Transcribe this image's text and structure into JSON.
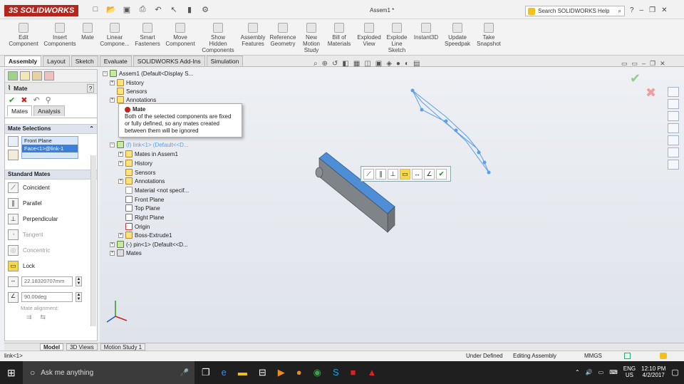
{
  "app": {
    "logo": "3S SOLIDWORKS",
    "document_title": "Assem1 *"
  },
  "help_search": {
    "placeholder": "Search SOLIDWORKS Help"
  },
  "ribbon": [
    {
      "id": "edit-component",
      "label": "Edit\nComponent"
    },
    {
      "id": "insert-components",
      "label": "Insert\nComponents"
    },
    {
      "id": "mate",
      "label": "Mate"
    },
    {
      "id": "linear-component",
      "label": "Linear\nCompone..."
    },
    {
      "id": "smart-fasteners",
      "label": "Smart\nFasteners"
    },
    {
      "id": "move-component",
      "label": "Move\nComponent"
    },
    {
      "id": "show-hidden",
      "label": "Show\nHidden\nComponents"
    },
    {
      "id": "assembly-features",
      "label": "Assembly\nFeatures"
    },
    {
      "id": "reference-geometry",
      "label": "Reference\nGeometry"
    },
    {
      "id": "new-motion-study",
      "label": "New\nMotion\nStudy"
    },
    {
      "id": "bill-of-materials",
      "label": "Bill of\nMaterials"
    },
    {
      "id": "exploded-view",
      "label": "Exploded\nView"
    },
    {
      "id": "explode-line-sketch",
      "label": "Explode\nLine\nSketch"
    },
    {
      "id": "instant3d",
      "label": "Instant3D"
    },
    {
      "id": "update-speedpak",
      "label": "Update\nSpeedpak"
    },
    {
      "id": "take-snapshot",
      "label": "Take\nSnapshot"
    }
  ],
  "tabs": [
    "Assembly",
    "Layout",
    "Sketch",
    "Evaluate",
    "SOLIDWORKS Add-Ins",
    "Simulation"
  ],
  "property_manager": {
    "title": "Mate",
    "help": "?",
    "subtabs": [
      "Mates",
      "Analysis"
    ],
    "mate_selections_title": "Mate Selections",
    "selections": [
      "Front Plane",
      "Face<1>@link-1"
    ],
    "standard_mates_title": "Standard Mates",
    "mates": [
      {
        "label": "Coincident",
        "enabled": true
      },
      {
        "label": "Parallel",
        "enabled": true
      },
      {
        "label": "Perpendicular",
        "enabled": true
      },
      {
        "label": "Tangent",
        "enabled": false
      },
      {
        "label": "Concentric",
        "enabled": false
      },
      {
        "label": "Lock",
        "enabled": true
      }
    ],
    "distance_value": "22.18320707mm",
    "angle_value": "90.00deg",
    "mate_alignment": "Mate alignment:"
  },
  "tree": {
    "root": "Assem1  (Default<Display S...",
    "items": [
      {
        "label": "History",
        "indent": 1
      },
      {
        "label": "Sensors",
        "indent": 1
      },
      {
        "label": "Annotations",
        "indent": 1
      },
      {
        "label": "(f) link<1> (Default<<D...",
        "indent": 1
      },
      {
        "label": "Mates in Assem1",
        "indent": 2
      },
      {
        "label": "History",
        "indent": 2
      },
      {
        "label": "Sensors",
        "indent": 2
      },
      {
        "label": "Annotations",
        "indent": 2
      },
      {
        "label": "Material <not specif...",
        "indent": 2
      },
      {
        "label": "Front Plane",
        "indent": 2
      },
      {
        "label": "Top Plane",
        "indent": 2
      },
      {
        "label": "Right Plane",
        "indent": 2
      },
      {
        "label": "Origin",
        "indent": 2
      },
      {
        "label": "Boss-Extrude1",
        "indent": 2
      },
      {
        "label": "(-) pin<1> (Default<<D...",
        "indent": 1
      },
      {
        "label": "Mates",
        "indent": 1
      }
    ]
  },
  "tooltip": {
    "title": "Mate",
    "message": "Both of the selected components are fixed or fully defined, so any mates created between them will be ignored"
  },
  "bottom_tabs": [
    "Model",
    "3D Views",
    "Motion Study 1"
  ],
  "status": {
    "left": "link<1>",
    "define_state": "Under Defined",
    "mode": "Editing Assembly",
    "units": "MMGS"
  },
  "taskbar": {
    "search_placeholder": "Ask me anything",
    "lang_top": "ENG",
    "lang_bottom": "US",
    "time": "12:10 PM",
    "date": "4/2/2017"
  }
}
